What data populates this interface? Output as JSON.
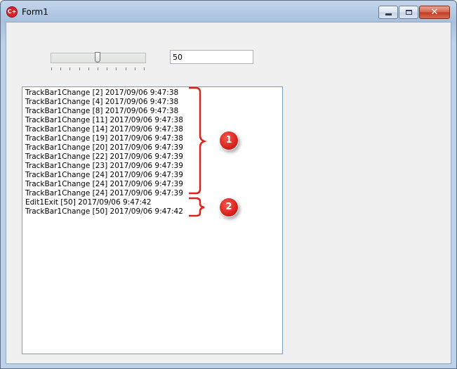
{
  "window": {
    "title": "Form1",
    "icon": "app-logo-icon"
  },
  "trackbar": {
    "position": 5,
    "max": 10
  },
  "edit": {
    "value": "50"
  },
  "memo": {
    "lines": [
      "TrackBar1Change [2] 2017/09/06 9:47:38",
      "TrackBar1Change [4] 2017/09/06 9:47:38",
      "TrackBar1Change [8] 2017/09/06 9:47:38",
      "TrackBar1Change [11] 2017/09/06 9:47:38",
      "TrackBar1Change [14] 2017/09/06 9:47:38",
      "TrackBar1Change [19] 2017/09/06 9:47:38",
      "TrackBar1Change [20] 2017/09/06 9:47:39",
      "TrackBar1Change [22] 2017/09/06 9:47:39",
      "TrackBar1Change [23] 2017/09/06 9:47:39",
      "TrackBar1Change [24] 2017/09/06 9:47:39",
      "TrackBar1Change [24] 2017/09/06 9:47:39",
      "TrackBar1Change [24] 2017/09/06 9:47:39",
      "Edit1Exit [50] 2017/09/06 9:47:42",
      "TrackBar1Change [50] 2017/09/06 9:47:42"
    ]
  },
  "annotations": {
    "badge1": "1",
    "badge2": "2",
    "color": "#e0201a"
  }
}
